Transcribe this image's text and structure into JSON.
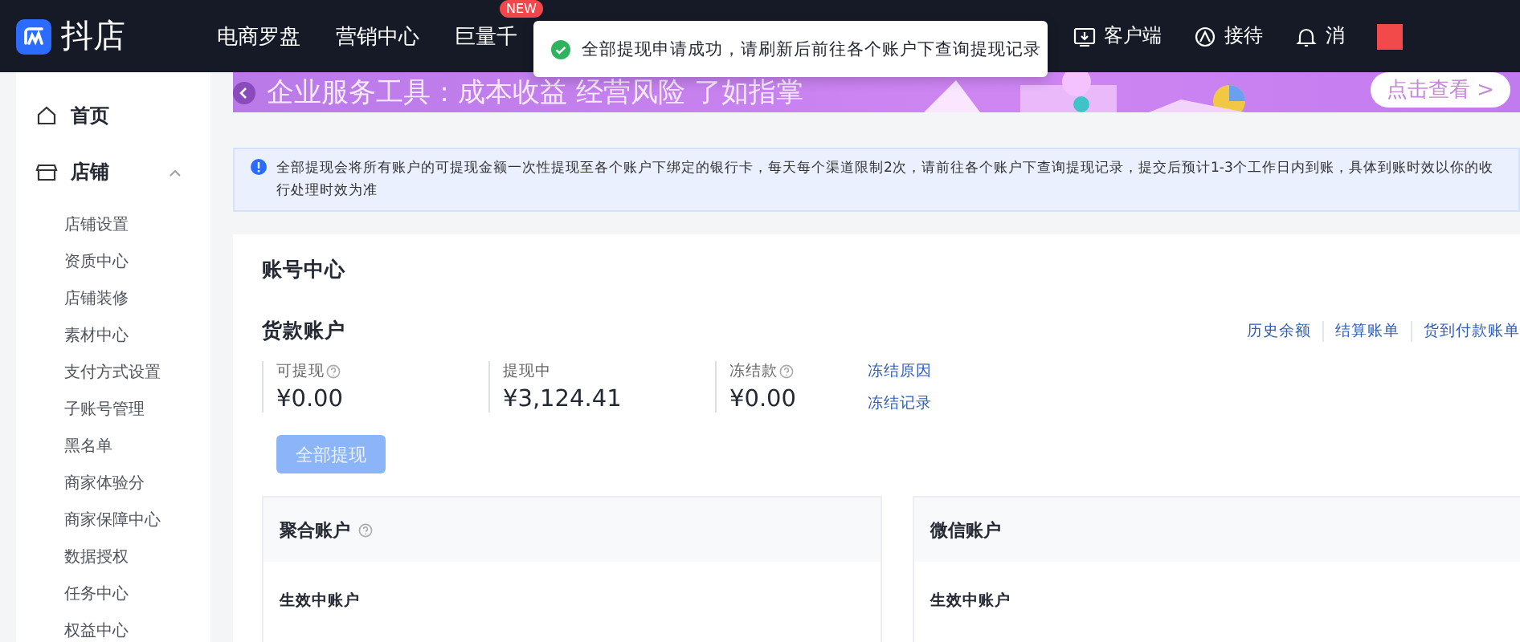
{
  "header": {
    "logo_text": "抖店",
    "nav": [
      {
        "label": "电商罗盘"
      },
      {
        "label": "营销中心"
      },
      {
        "label": "巨量千",
        "badge": "NEW"
      }
    ],
    "actions": [
      {
        "kind": "client",
        "label": "客户端"
      },
      {
        "kind": "reception",
        "label": "接待"
      },
      {
        "kind": "bell",
        "label": "消"
      }
    ]
  },
  "toast": {
    "kind": "success",
    "message": "全部提现申请成功，请刷新后前往各个账户下查询提现记录"
  },
  "banner": {
    "title": "企业服务工具：成本收益 经营风险 了如指掌",
    "button": "点击查看 >"
  },
  "sidebar": {
    "items": [
      {
        "kind": "home",
        "label": "首页"
      },
      {
        "kind": "shop",
        "label": "店铺",
        "expanded": true,
        "children": [
          {
            "label": "店铺设置"
          },
          {
            "label": "资质中心"
          },
          {
            "label": "店铺装修"
          },
          {
            "label": "素材中心"
          },
          {
            "label": "支付方式设置"
          },
          {
            "label": "子账号管理"
          },
          {
            "label": "黑名单"
          },
          {
            "label": "商家体验分"
          },
          {
            "label": "商家保障中心"
          },
          {
            "label": "数据授权"
          },
          {
            "label": "任务中心"
          },
          {
            "label": "权益中心"
          }
        ]
      }
    ]
  },
  "notice": {
    "lines": [
      "全部提现会将所有账户的可提现金额一次性提现至各个账户下绑定的银行卡，每天每个渠道限制2次，请前往各个账户下查询提现记录，提交后预计1-3个工作日内到账，具体到账时效以你的收",
      "行处理时效为准"
    ]
  },
  "page_title": "账号中心",
  "account": {
    "title": "货款账户",
    "links": [
      "历史余额",
      "结算账单",
      "货到付款账单"
    ],
    "stats": [
      {
        "label": "可提现",
        "help": true,
        "value": "¥0.00"
      },
      {
        "label": "提现中",
        "help": false,
        "value": "¥3,124.41"
      },
      {
        "label": "冻结款",
        "help": true,
        "value": "¥0.00"
      }
    ],
    "frozen_links": [
      "冻结原因",
      "冻结记录"
    ],
    "withdraw_button": {
      "label": "全部提现",
      "disabled": true
    }
  },
  "sub_accounts": [
    {
      "title": "聚合账户",
      "help": true,
      "section": "生效中账户"
    },
    {
      "title": "微信账户",
      "help": false,
      "section": "生效中账户"
    }
  ]
}
